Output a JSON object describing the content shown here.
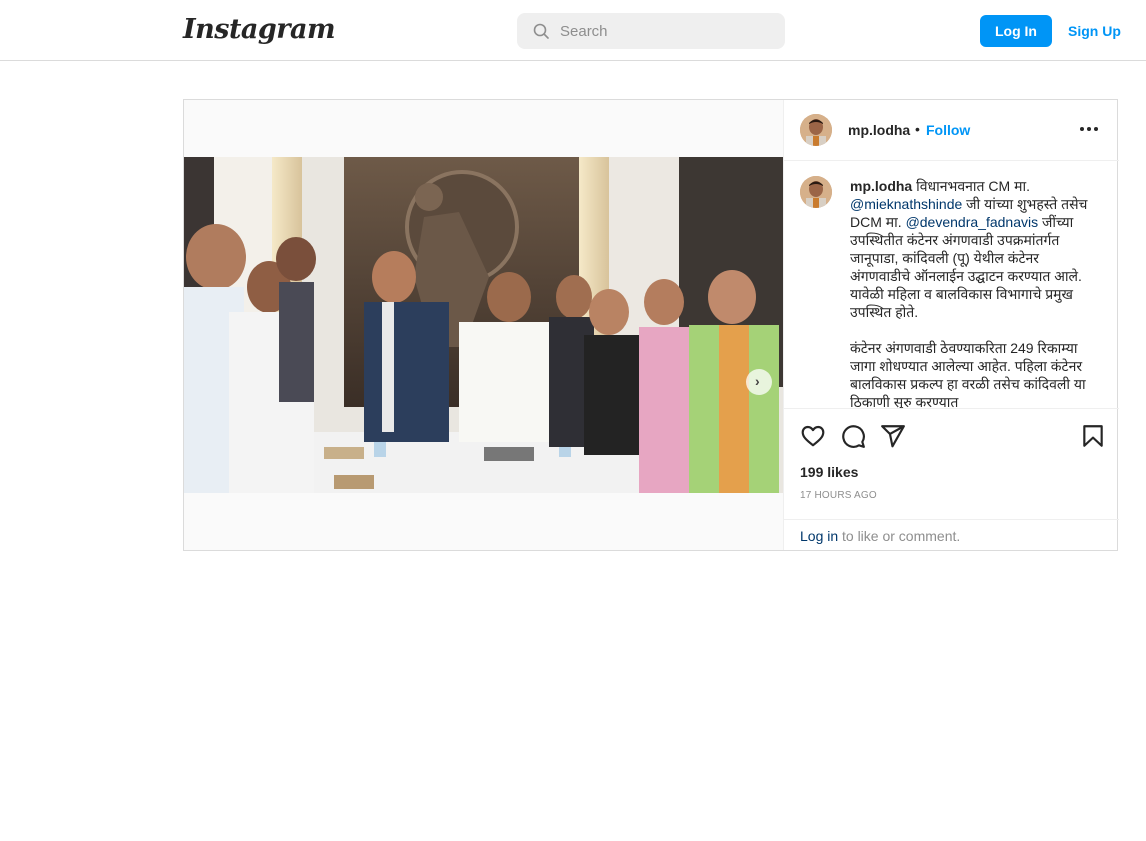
{
  "header": {
    "logo": "Instagram",
    "search_placeholder": "Search",
    "login_label": "Log In",
    "signup_label": "Sign Up"
  },
  "post": {
    "username": "mp.lodha",
    "separator": "•",
    "follow_label": "Follow",
    "caption": {
      "t1": " विधानभवनात CM मा. ",
      "m1": "@mieknathshinde",
      "t2": " जी यांच्या शुभहस्ते तसेच DCM मा. ",
      "m2": "@devendra_fadnavis",
      "t3": " जींच्या उपस्थितीत कंटेनर अंगणवाडी उपक्रमांतर्गत जानूपाडा, कांदिवली (पू) येथील कंटेनर अंगणवाडीचे ऑनलाईन उद्घाटन करण्यात आले. यावेळी महिला व बालविकास विभागाचे प्रमुख उपस्थित होते.",
      "p2": "कंटेनर अंगणवाडी ठेवण्याकरिता 249 रिकाम्या जागा शोधण्यात आलेल्या आहेत. पहिला कंटेनर बालविकास प्रकल्प हा वरळी तसेच कांदिवली या ठिकाणी सुरु करण्यात"
    },
    "likes": "199 likes",
    "time": "17 HOURS AGO",
    "footer": {
      "login_link": "Log in",
      "rest": " to like or comment."
    },
    "carousel_slides": 6,
    "carousel_active_index": 0
  },
  "colors": {
    "accent": "#0095f6",
    "link": "#00376b",
    "border": "#dbdbdb"
  }
}
